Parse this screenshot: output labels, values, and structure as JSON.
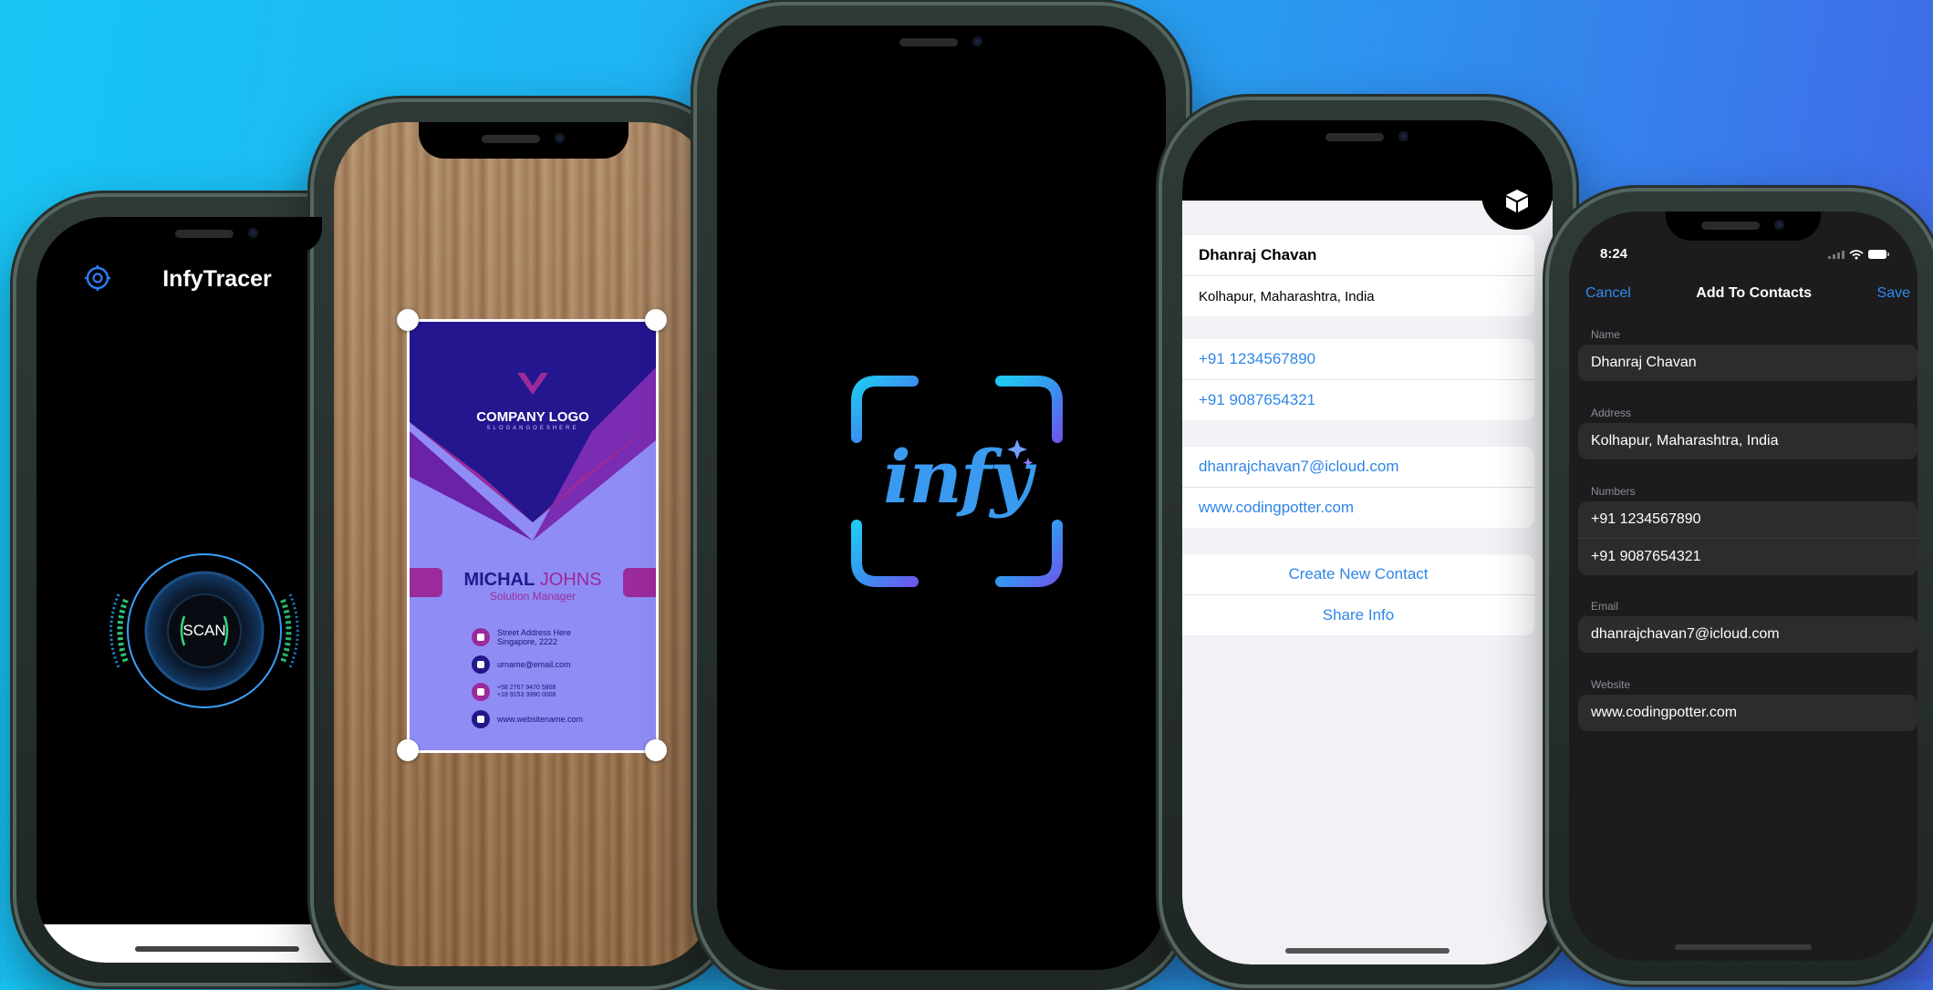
{
  "phone1": {
    "app_title": "InfyTracer",
    "scan_label": "SCAN",
    "icons": [
      "settings-gear-icon"
    ]
  },
  "phone2": {
    "card": {
      "company": "COMPANY LOGO",
      "slogan": "SLOGANGOESHERE",
      "first_name": "MICHAL",
      "last_name": "JOHNS",
      "role": "Solution Manager",
      "address_line1": "Street Address Here",
      "address_line2": "Singapore, 2222",
      "email": "urname@email.com",
      "phone_line1": "+58 2767 9470 5808",
      "phone_line2": "+18 9153 3990 0008",
      "website": "www.websitename.com"
    }
  },
  "phone3": {
    "logo_text": "infy"
  },
  "phone4": {
    "name": "Dhanraj Chavan",
    "address": "Kolhapur, Maharashtra, India",
    "phones": [
      "+91 1234567890",
      "+91 9087654321"
    ],
    "email": "dhanrajchavan7@icloud.com",
    "website": "www.codingpotter.com",
    "create_button": "Create New Contact",
    "share_button": "Share Info",
    "icons": [
      "ar-cube-icon"
    ]
  },
  "phone5": {
    "time": "8:24",
    "nav": {
      "cancel": "Cancel",
      "title": "Add To Contacts",
      "save": "Save"
    },
    "labels": {
      "name": "Name",
      "address": "Address",
      "numbers": "Numbers",
      "email": "Email",
      "website": "Website"
    },
    "values": {
      "name": "Dhanraj Chavan",
      "address": "Kolhapur, Maharashtra, India",
      "numbers": [
        "+91 1234567890",
        "+91 9087654321"
      ],
      "email": "dhanrajchavan7@icloud.com",
      "website": "www.codingpotter.com"
    },
    "icons": [
      "wifi-icon",
      "battery-icon",
      "signal-icon"
    ]
  },
  "colors": {
    "ios_blue": "#2f86e6",
    "card_purple": "#8f8df5",
    "card_navy": "#21198a",
    "card_magenta": "#9b2a9a"
  }
}
